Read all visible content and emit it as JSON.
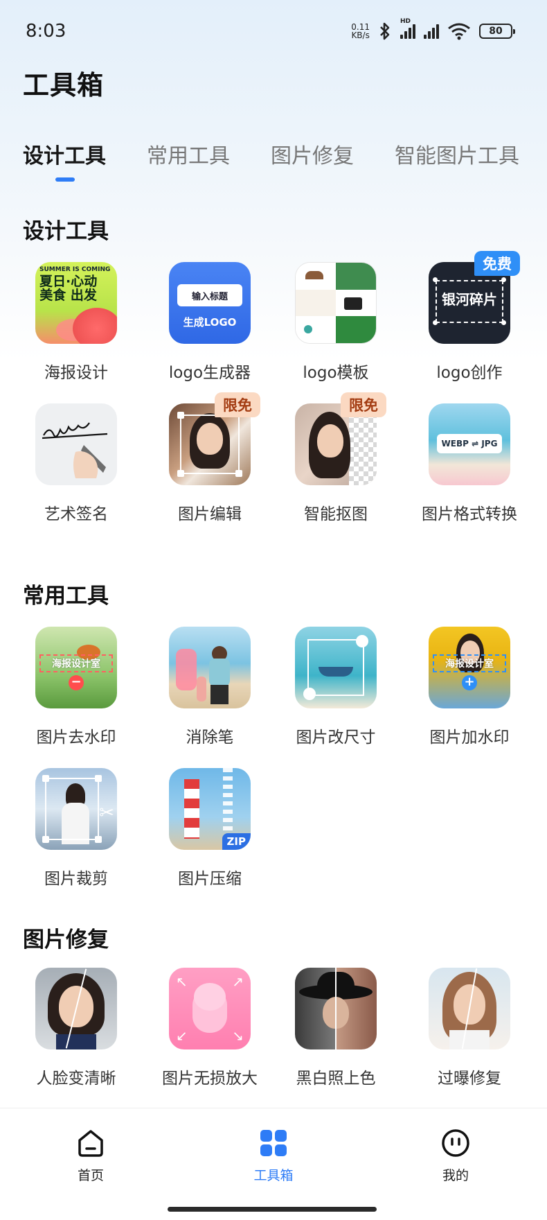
{
  "status_bar": {
    "time": "8:03",
    "net_speed_value": "0.11",
    "net_speed_unit": "KB/s",
    "hd_label": "HD",
    "battery": "80"
  },
  "app_title": "工具箱",
  "tabs": [
    {
      "label": "设计工具",
      "active": true
    },
    {
      "label": "常用工具",
      "active": false
    },
    {
      "label": "图片修复",
      "active": false
    },
    {
      "label": "智能图片工具",
      "active": false
    }
  ],
  "sections": {
    "design": {
      "title": "设计工具",
      "tools": [
        {
          "label": "海报设计",
          "icon": "poster-design-icon"
        },
        {
          "label": "logo生成器",
          "icon": "logo-generator-icon"
        },
        {
          "label": "logo模板",
          "icon": "logo-template-icon"
        },
        {
          "label": "logo创作",
          "icon": "logo-create-icon",
          "badge": "免费"
        },
        {
          "label": "艺术签名",
          "icon": "art-signature-icon"
        },
        {
          "label": "图片编辑",
          "icon": "image-edit-icon",
          "badge": "限免"
        },
        {
          "label": "智能抠图",
          "icon": "smart-cutout-icon",
          "badge": "限免"
        },
        {
          "label": "图片格式转换",
          "icon": "format-convert-icon"
        }
      ],
      "poster_art": {
        "line1": "SUMMER IS COMING",
        "line2": "夏日·心动",
        "line3": "美食 出发"
      },
      "logo_gen_art": {
        "input": "输入标题",
        "action": "生成LOGO"
      },
      "logo_create_art": {
        "text": "银河碎片"
      },
      "format_art": {
        "text": "WEBP ⇌ JPG"
      }
    },
    "common": {
      "title": "常用工具",
      "tools": [
        {
          "label": "图片去水印",
          "icon": "remove-watermark-icon"
        },
        {
          "label": "消除笔",
          "icon": "eraser-pen-icon"
        },
        {
          "label": "图片改尺寸",
          "icon": "resize-icon"
        },
        {
          "label": "图片加水印",
          "icon": "add-watermark-icon"
        },
        {
          "label": "图片裁剪",
          "icon": "crop-icon"
        },
        {
          "label": "图片压缩",
          "icon": "compress-icon"
        }
      ],
      "watermark_text": "海报设计室",
      "zip_text": "ZIP"
    },
    "repair": {
      "title": "图片修复",
      "tools": [
        {
          "label": "人脸变清晰",
          "icon": "face-enhance-icon"
        },
        {
          "label": "图片无损放大",
          "icon": "lossless-upscale-icon"
        },
        {
          "label": "黑白照上色",
          "icon": "colorize-icon"
        },
        {
          "label": "过曝修复",
          "icon": "overexposure-fix-icon"
        }
      ]
    }
  },
  "bottom_nav": [
    {
      "label": "首页",
      "icon": "home-icon",
      "active": false
    },
    {
      "label": "工具箱",
      "icon": "toolbox-icon",
      "active": true
    },
    {
      "label": "我的",
      "icon": "profile-icon",
      "active": false
    }
  ],
  "colors": {
    "accent": "#2e7cf6",
    "free_badge": "#2f8ff7",
    "limited_badge": "#fbd9c2"
  }
}
